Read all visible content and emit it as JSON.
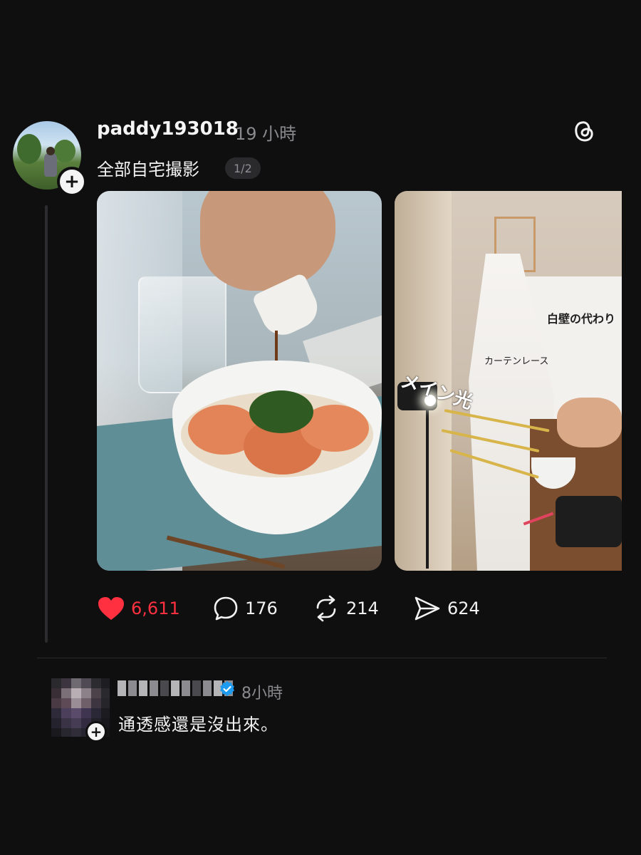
{
  "post": {
    "username": "paddy193018",
    "time": "19 小時",
    "caption": "全部自宅撮影",
    "page_indicator": "1/2",
    "image2_labels": {
      "wall": "白壁の代わり",
      "lace": "カーテンレース",
      "main_light": "メイン光"
    },
    "actions": {
      "likes": "6,611",
      "replies": "176",
      "reposts": "214",
      "shares": "624"
    }
  },
  "comment": {
    "time": "8小時",
    "text": "通透感還是沒出來。"
  },
  "colors": {
    "background": "#0f0f10",
    "like_red": "#ff3040",
    "verified_blue": "#1d9bf0",
    "muted_text": "#8a8a8e"
  },
  "icons": {
    "logo": "threads-logo-icon",
    "like": "heart-filled-icon",
    "reply": "speech-bubble-icon",
    "repost": "repost-arrows-icon",
    "share": "paper-plane-icon",
    "verified": "verified-badge-icon",
    "follow": "plus-icon"
  }
}
